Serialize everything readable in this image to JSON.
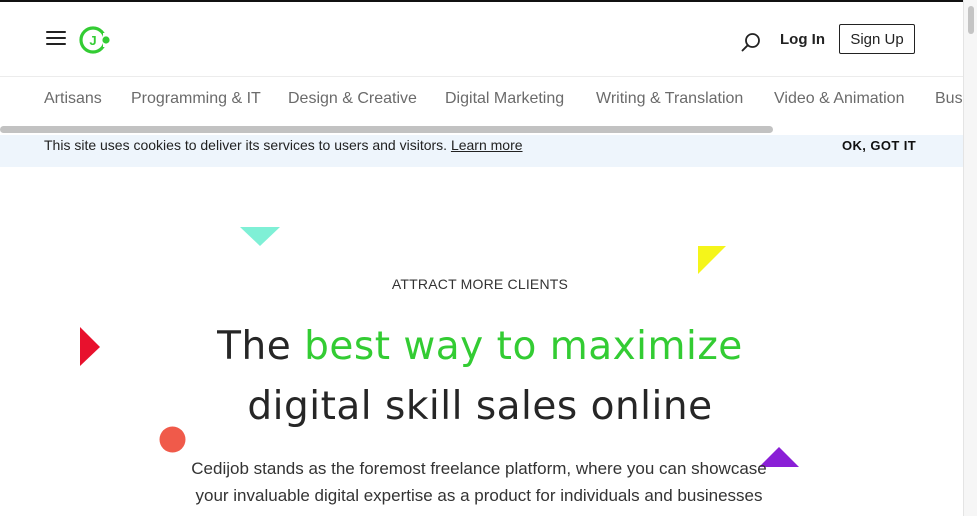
{
  "header": {
    "menu_icon": "hamburger-menu-icon",
    "logo_icon": "cedijob-logo-icon",
    "logo_letter": "J",
    "search_icon": "search-icon",
    "login_label": "Log In",
    "signup_label": "Sign Up"
  },
  "categories": [
    "Artisans",
    "Programming & IT",
    "Design & Creative",
    "Digital Marketing",
    "Writing & Translation",
    "Video & Animation",
    "Bus"
  ],
  "cookie_banner": {
    "message": "This site uses cookies to deliver its services to users and visitors.",
    "learn_more": "Learn more",
    "accept_label": "OK, GOT IT"
  },
  "hero": {
    "eyebrow": "ATTRACT MORE CLIENTS",
    "headline_start": "The",
    "headline_accent": "best way to maximize",
    "headline_end": "digital skill sales online",
    "description": "Cedijob stands as the foremost freelance platform, where you can showcase your invaluable digital expertise as a product for individuals and businesses alike. Start selling your digital skills today."
  },
  "colors": {
    "brand_green": "#33cc33",
    "cookie_bg": "#eef5fc",
    "shape_mint": "#7ff0d6",
    "shape_yellow": "#f5f51a",
    "shape_red": "#e8112d",
    "shape_coral": "#f05a4a",
    "shape_purple": "#8a1fd6"
  }
}
